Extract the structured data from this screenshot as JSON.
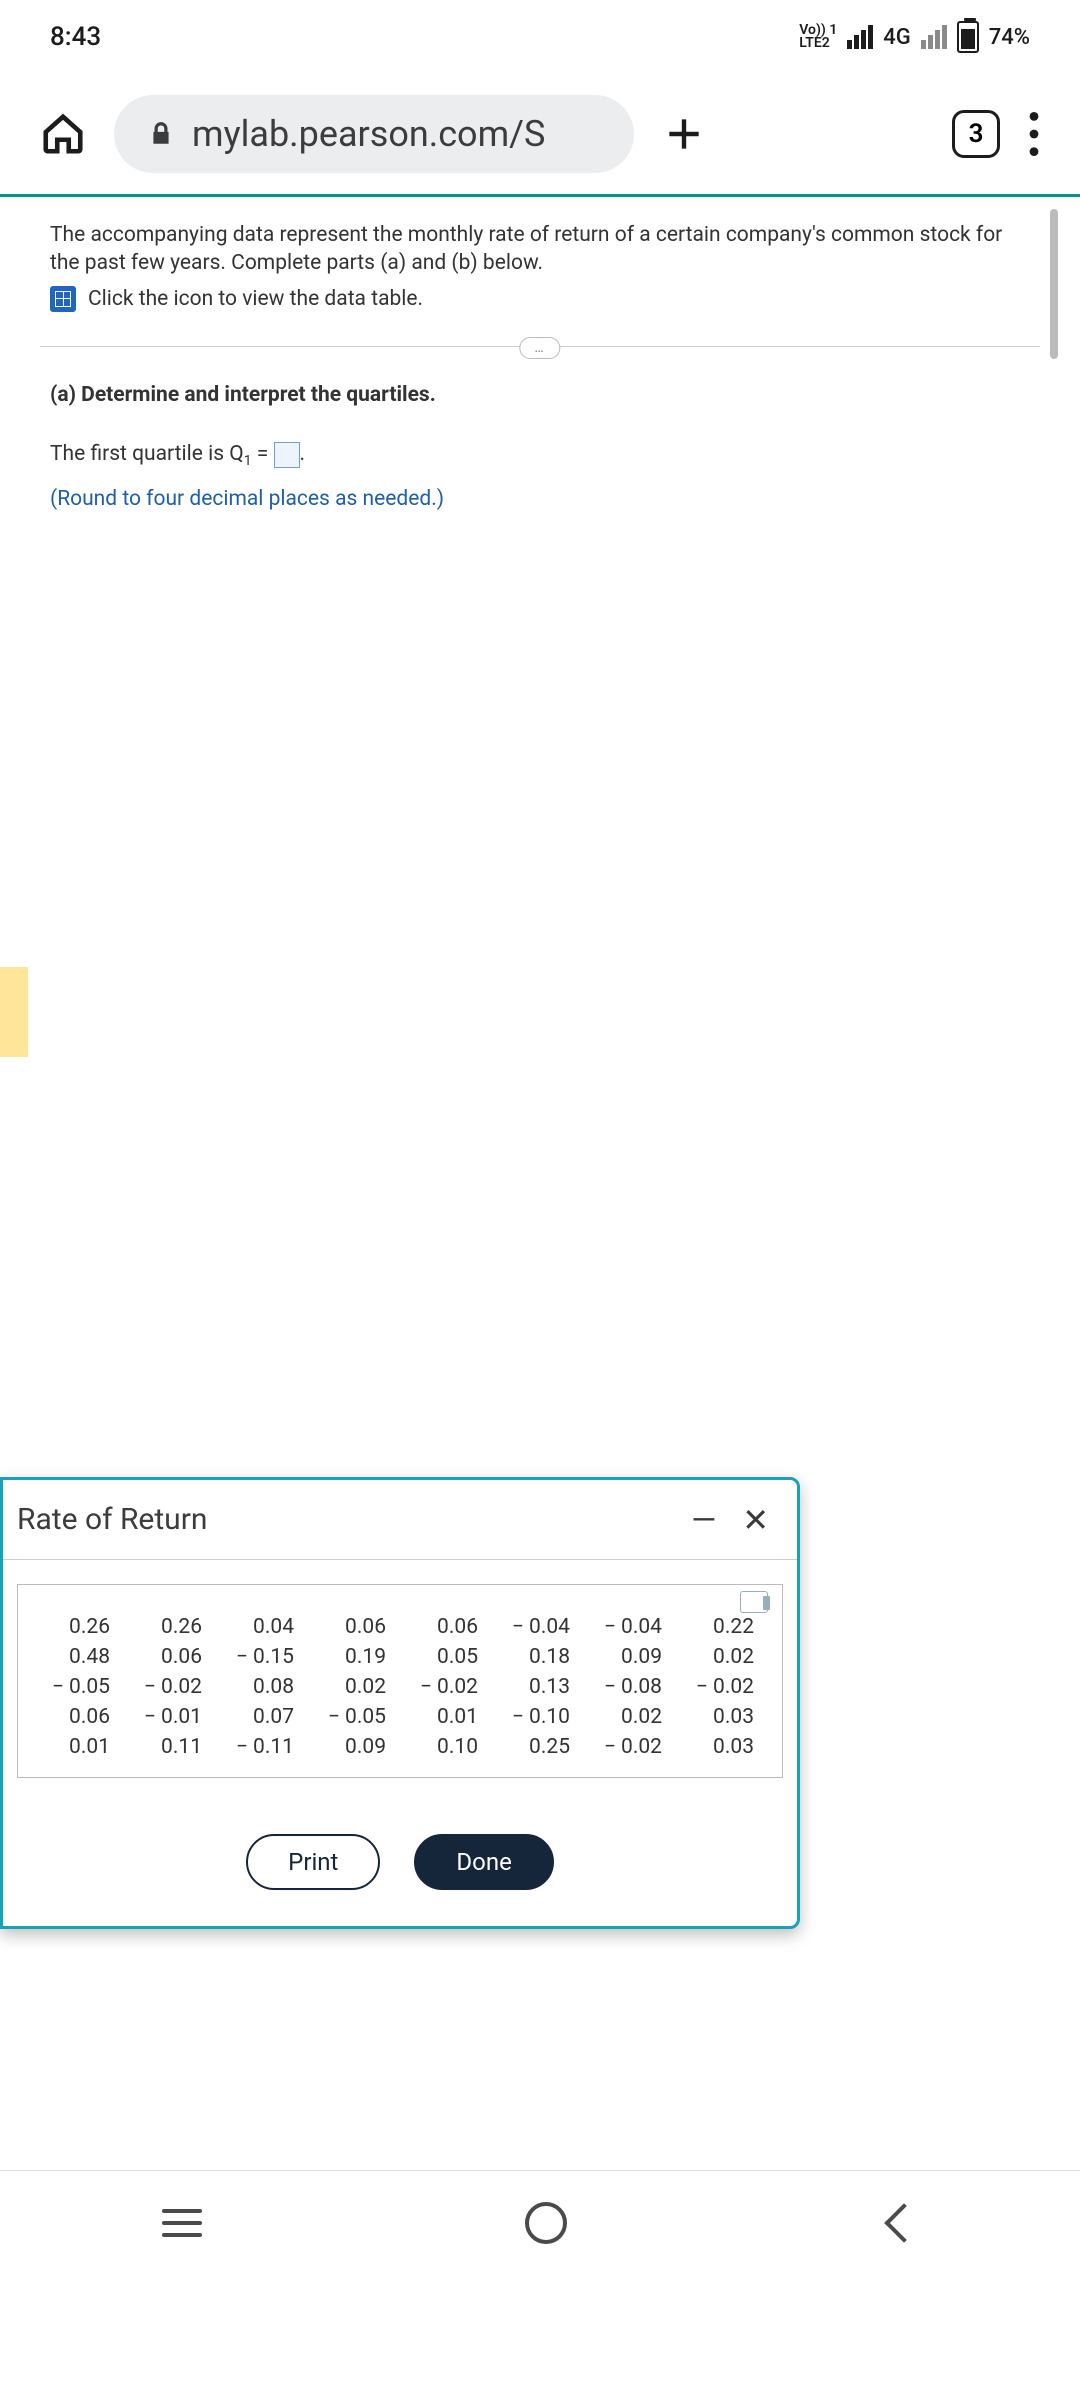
{
  "status": {
    "time": "8:43",
    "net1": "Vo)) 1",
    "net2": "LTE2",
    "g": "4G",
    "battery": "74%"
  },
  "chrome": {
    "url": "mylab.pearson.com/S",
    "tabs": "3"
  },
  "problem": {
    "intro": "The accompanying data represent the monthly rate of return of a certain company's common stock for the past few years. Complete parts (a) and (b) below.",
    "data_link": "Click the icon to view the data table.",
    "ellipsis": "…",
    "part_a": "(a) Determine and interpret the quartiles.",
    "q_line_pre": "The first quartile is Q",
    "q_sub": "1",
    "q_line_post": " = ",
    "q_end": ".",
    "hint": "(Round to four decimal places as needed.)"
  },
  "modal": {
    "title": "Rate of Return",
    "minimize": "—",
    "close": "✕",
    "print": "Print",
    "done": "Done",
    "cells": [
      "0.26",
      "0.26",
      "0.04",
      "0.06",
      "0.06",
      "− 0.04",
      "− 0.04",
      "0.22",
      "0.48",
      "0.06",
      "− 0.15",
      "0.19",
      "0.05",
      "0.18",
      "0.09",
      "0.02",
      "− 0.05",
      "− 0.02",
      "0.08",
      "0.02",
      "− 0.02",
      "0.13",
      "− 0.08",
      "− 0.02",
      "0.06",
      "− 0.01",
      "0.07",
      "− 0.05",
      "0.01",
      "− 0.10",
      "0.02",
      "0.03",
      "0.01",
      "0.11",
      "− 0.11",
      "0.09",
      "0.10",
      "0.25",
      "− 0.02",
      "0.03"
    ]
  },
  "chart_data": {
    "type": "table",
    "title": "Rate of Return",
    "values": [
      [
        0.26,
        0.26,
        0.04,
        0.06,
        0.06,
        -0.04,
        -0.04,
        0.22
      ],
      [
        0.48,
        0.06,
        -0.15,
        0.19,
        0.05,
        0.18,
        0.09,
        0.02
      ],
      [
        -0.05,
        -0.02,
        0.08,
        0.02,
        -0.02,
        0.13,
        -0.08,
        -0.02
      ],
      [
        0.06,
        -0.01,
        0.07,
        -0.05,
        0.01,
        -0.1,
        0.02,
        0.03
      ],
      [
        0.01,
        0.11,
        -0.11,
        0.09,
        0.1,
        0.25,
        -0.02,
        0.03
      ]
    ]
  }
}
